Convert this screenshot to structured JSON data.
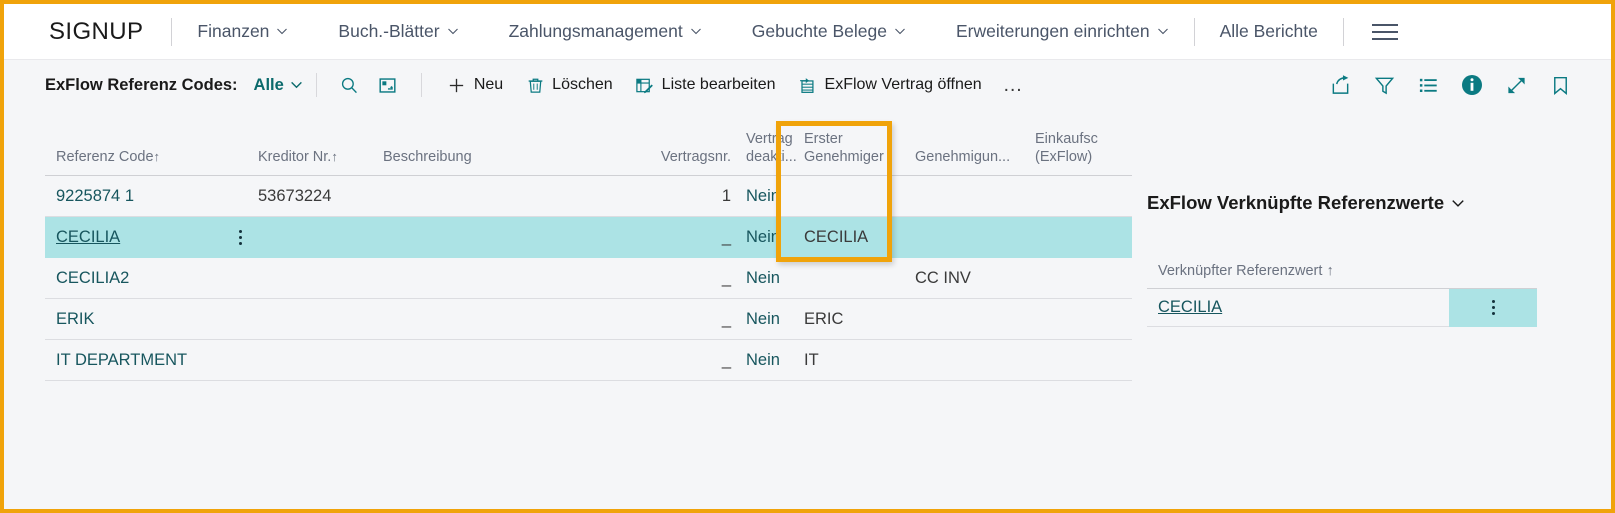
{
  "topnav": {
    "brand": "SIGNUP",
    "items": [
      {
        "label": "Finanzen",
        "caret": true
      },
      {
        "label": "Buch.-Blätter",
        "caret": true
      },
      {
        "label": "Zahlungsmanagement",
        "caret": true
      },
      {
        "label": "Gebuchte Belege",
        "caret": true
      },
      {
        "label": "Erweiterungen einrichten",
        "caret": true
      },
      {
        "label": "Alle Berichte",
        "caret": false
      }
    ],
    "menu_icon": "hamburger-icon"
  },
  "commandbar": {
    "title": "ExFlow Referenz Codes:",
    "filter_value": "Alle",
    "search_icon": "search-icon",
    "card_icon": "open-in-new-window-icon",
    "buttons": [
      {
        "label": "Neu",
        "icon": "plus-icon"
      },
      {
        "label": "Löschen",
        "icon": "trash-icon"
      },
      {
        "label": "Liste bearbeiten",
        "icon": "edit-list-icon"
      },
      {
        "label": "ExFlow Vertrag öffnen",
        "icon": "open-contract-icon"
      }
    ],
    "overflow": "…",
    "right_icons": [
      "share-icon",
      "filter-icon",
      "list-view-icon",
      "info-icon",
      "expand-icon",
      "bookmark-icon"
    ]
  },
  "table": {
    "columns": [
      {
        "key": "code",
        "label": "Referenz Code",
        "sort": "↑"
      },
      {
        "key": "kred",
        "label": "Kreditor Nr.",
        "sort": "↑"
      },
      {
        "key": "besch",
        "label": "Beschreibung",
        "sort": ""
      },
      {
        "key": "vnr",
        "label": "Vertragsnr.",
        "sort": ""
      },
      {
        "key": "deakt",
        "label": "Vertrag\ndeakti...",
        "sort": ""
      },
      {
        "key": "erster",
        "label": "Erster\nGenehmiger",
        "sort": ""
      },
      {
        "key": "genehm",
        "label": "Genehmigun...",
        "sort": ""
      },
      {
        "key": "eink",
        "label": "Einkaufsc\n(ExFlow)",
        "sort": ""
      }
    ],
    "rows": [
      {
        "code": "9225874 1",
        "kred": "53673224",
        "besch": "",
        "vnr": "1",
        "deakt": "Nein",
        "erster": "",
        "genehm": "",
        "eink": "",
        "selected": false
      },
      {
        "code": "CECILIA",
        "kred": "",
        "besch": "",
        "vnr": "_",
        "deakt": "Nein",
        "erster": "CECILIA",
        "genehm": "",
        "eink": "",
        "selected": true
      },
      {
        "code": "CECILIA2",
        "kred": "",
        "besch": "",
        "vnr": "_",
        "deakt": "Nein",
        "erster": "",
        "genehm": "CC INV",
        "eink": "",
        "selected": false
      },
      {
        "code": "ERIK",
        "kred": "",
        "besch": "",
        "vnr": "_",
        "deakt": "Nein",
        "erster": "ERIC",
        "genehm": "",
        "eink": "",
        "selected": false
      },
      {
        "code": "IT DEPARTMENT",
        "kred": "",
        "besch": "",
        "vnr": "_",
        "deakt": "Nein",
        "erster": "IT",
        "genehm": "",
        "eink": "",
        "selected": false
      }
    ]
  },
  "factbox": {
    "title": "ExFlow Verknüpfte Referenzwerte",
    "column_header": "Verknüpfter Referenzwert ↑",
    "rows": [
      {
        "value": "CECILIA"
      }
    ]
  },
  "highlight": {
    "color": "#f0a30a",
    "target_column": "Erster Genehmiger"
  },
  "colors": {
    "accent_teal": "#0b7a82",
    "selection": "#ace3e5",
    "page_bg": "#f5f6f8",
    "highlight_orange": "#f0a30a"
  }
}
